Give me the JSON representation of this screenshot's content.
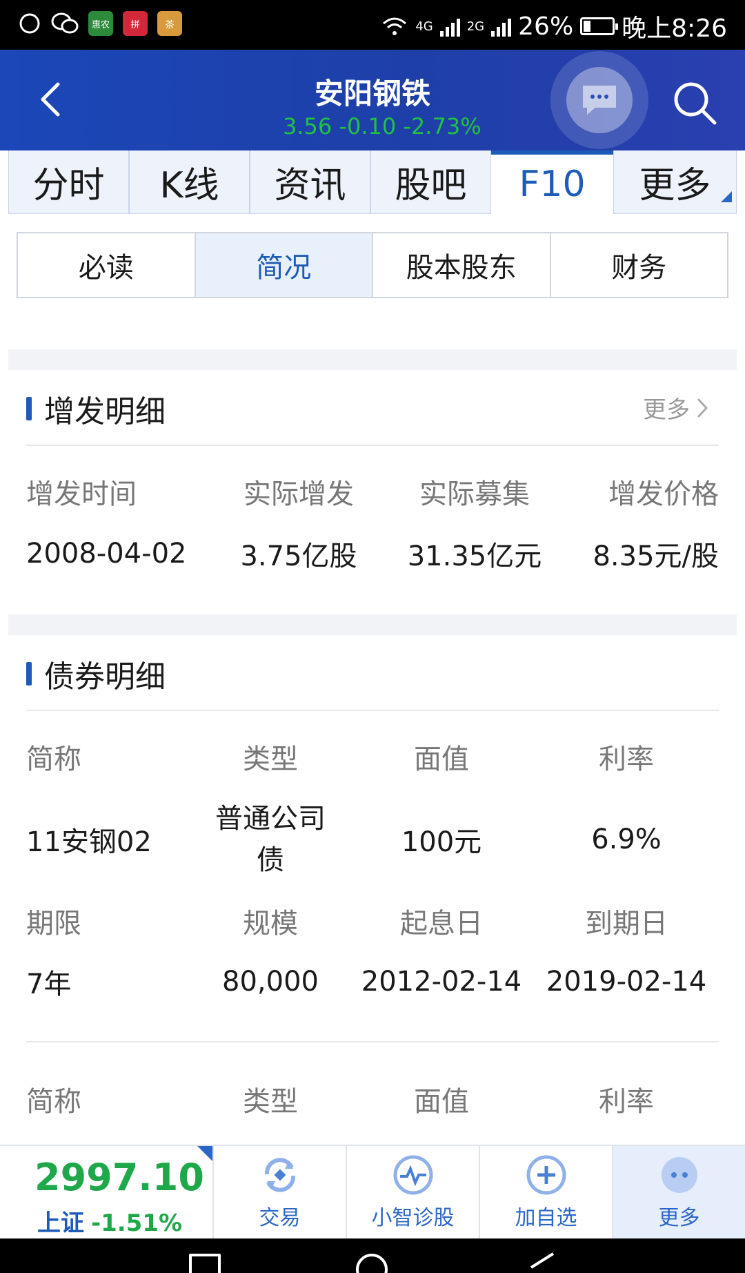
{
  "status_bar": {
    "apps": [
      "惠农",
      "拼",
      "茶"
    ],
    "network_4g": "4G",
    "network_2g": "2G",
    "battery": "26%",
    "time": "晚上8:26",
    "battery_level": 0.26
  },
  "header": {
    "title": "安阳钢铁",
    "quote": "3.56  -0.10  -2.73%"
  },
  "main_tabs": [
    "分时",
    "K线",
    "资讯",
    "股吧",
    "F10",
    "更多"
  ],
  "active_main_tab": "F10",
  "sub_tabs": [
    "必读",
    "简况",
    "股本股东",
    "财务"
  ],
  "active_sub_tab": "简况",
  "placement_section": {
    "title": "增发明细",
    "more_label": "更多",
    "headers": [
      "增发时间",
      "实际增发",
      "实际募集",
      "增发价格"
    ],
    "values": [
      "2008-04-02",
      "3.75亿股",
      "31.35亿元",
      "8.35元/股"
    ]
  },
  "bond_section": {
    "title": "债券明细",
    "bond1": {
      "headers1": [
        "简称",
        "类型",
        "面值",
        "利率"
      ],
      "values1": [
        "11安钢02",
        "普通公司债",
        "100元",
        "6.9%"
      ],
      "headers2": [
        "期限",
        "规模",
        "起息日",
        "到期日"
      ],
      "values2": [
        "7年",
        "80,000",
        "2012-02-14",
        "2019-02-14"
      ]
    },
    "bond2": {
      "headers1": [
        "简称",
        "类型",
        "面值",
        "利率"
      ]
    }
  },
  "bottom_bar": {
    "index_value": "2997.10",
    "index_name": "上证",
    "index_change": "-1.51%",
    "items": [
      "交易",
      "小智诊股",
      "加自选",
      "更多"
    ]
  },
  "colors": {
    "header_blue": "#1e3fa8",
    "accent_blue": "#1d5bb8",
    "down_green": "#1fa84a"
  }
}
